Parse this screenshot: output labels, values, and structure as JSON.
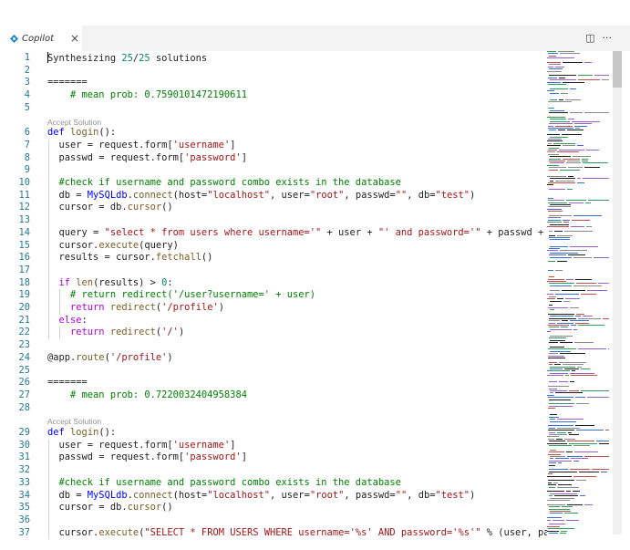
{
  "tab": {
    "title": "Copilot",
    "close": "×",
    "icon": "copilot-icon",
    "actions": [
      {
        "name": "split-editor-icon",
        "glyph": "◫"
      },
      {
        "name": "more-actions-icon",
        "glyph": "···"
      }
    ]
  },
  "editor": {
    "codelens": [
      "Accept Solution",
      "Accept Solution"
    ],
    "lines": [
      {
        "n": "1",
        "code": "Synthesizing 25/25 solutions"
      },
      {
        "n": "2",
        "code": ""
      },
      {
        "n": "3",
        "code": "======="
      },
      {
        "n": "4",
        "code": "    # mean prob: 0.7590101472190611"
      },
      {
        "n": "5",
        "code": ""
      },
      {
        "n": "6",
        "code": "def login():"
      },
      {
        "n": "7",
        "code": "  user = request.form['username']"
      },
      {
        "n": "8",
        "code": "  passwd = request.form['password']"
      },
      {
        "n": "9",
        "code": ""
      },
      {
        "n": "10",
        "code": "  #check if username and password combo exists in the database"
      },
      {
        "n": "11",
        "code": "  db = MySQLdb.connect(host=\"localhost\", user=\"root\", passwd=\"\", db=\"test\")"
      },
      {
        "n": "12",
        "code": "  cursor = db.cursor()"
      },
      {
        "n": "13",
        "code": ""
      },
      {
        "n": "14",
        "code": "  query = \"select * from users where username='\" + user + \"' and password='\" + passwd + \""
      },
      {
        "n": "15",
        "code": "  cursor.execute(query)"
      },
      {
        "n": "16",
        "code": "  results = cursor.fetchall()"
      },
      {
        "n": "17",
        "code": ""
      },
      {
        "n": "18",
        "code": "  if len(results) > 0:"
      },
      {
        "n": "19",
        "code": "    # return redirect('/user?username=' + user)"
      },
      {
        "n": "20",
        "code": "    return redirect('/profile')"
      },
      {
        "n": "21",
        "code": "  else:"
      },
      {
        "n": "22",
        "code": "    return redirect('/')"
      },
      {
        "n": "23",
        "code": ""
      },
      {
        "n": "24",
        "code": "@app.route('/profile')"
      },
      {
        "n": "25",
        "code": ""
      },
      {
        "n": "26",
        "code": "======="
      },
      {
        "n": "27",
        "code": "    # mean prob: 0.7220032404958384"
      },
      {
        "n": "28",
        "code": ""
      },
      {
        "n": "29",
        "code": "def login():"
      },
      {
        "n": "30",
        "code": "  user = request.form['username']"
      },
      {
        "n": "31",
        "code": "  passwd = request.form['password']"
      },
      {
        "n": "32",
        "code": ""
      },
      {
        "n": "33",
        "code": "  #check if username and password combo exists in the database"
      },
      {
        "n": "34",
        "code": "  db = MySQLdb.connect(host=\"localhost\", user=\"root\", passwd=\"\", db=\"test\")"
      },
      {
        "n": "35",
        "code": "  cursor = db.cursor()"
      },
      {
        "n": "36",
        "code": ""
      },
      {
        "n": "37",
        "code": "  cursor.execute(\"SELECT * FROM USERS WHERE username='%s' AND password='%s'\" % (user, pas"
      }
    ]
  },
  "colors": {
    "keyword": "#0000ff",
    "control": "#af00db",
    "string": "#a31515",
    "number": "#098658",
    "comment": "#008000",
    "function": "#795e26",
    "line_number": "#237893"
  }
}
